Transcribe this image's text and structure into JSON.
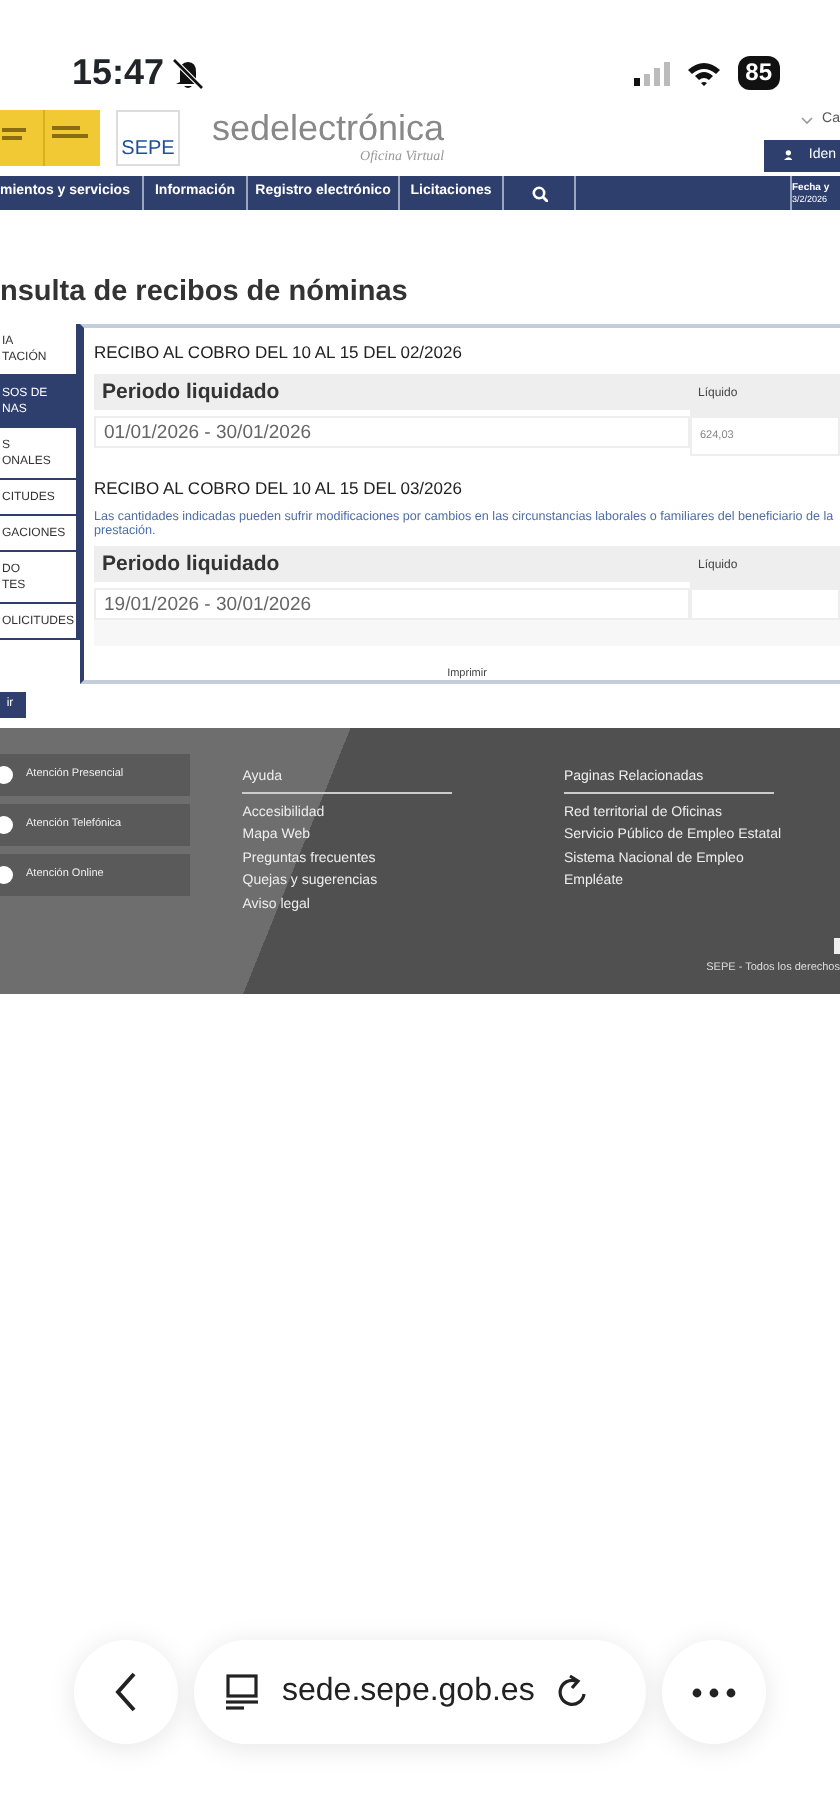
{
  "status_bar": {
    "time": "15:47",
    "battery": "85"
  },
  "header": {
    "logo_text": "SEPE",
    "brand": "sedelectrónica",
    "brand_subtitle": "Oficina Virtual",
    "language_link": "Ca",
    "login_button": "Iden"
  },
  "nav": {
    "items": [
      {
        "kind": "link",
        "label": "mientos y servicios"
      },
      {
        "kind": "link",
        "label": "Información"
      },
      {
        "kind": "link",
        "label": "Registro electrónico"
      },
      {
        "kind": "link",
        "label": "Licitaciones"
      },
      {
        "kind": "search"
      }
    ],
    "date_label": "Fecha y",
    "date": "3/2/2026"
  },
  "page_title": "nsulta de recibos de nóminas",
  "sidebar": {
    "items": [
      {
        "lines": [
          "IA",
          "TACIÓN"
        ],
        "selected": false
      },
      {
        "lines": [
          "SOS DE",
          "NAS"
        ],
        "selected": true
      },
      {
        "lines": [
          "S",
          "ONALES"
        ],
        "selected": false
      },
      {
        "lines": [
          "CITUDES"
        ],
        "selected": false
      },
      {
        "lines": [
          "GACIONES"
        ],
        "selected": false
      },
      {
        "lines": [
          "DO",
          "TES"
        ],
        "selected": false
      },
      {
        "lines": [
          "OLICITUDES"
        ],
        "selected": false
      }
    ]
  },
  "receipts": [
    {
      "title": "RECIBO AL COBRO DEL 10 AL 15 DEL 02/2026",
      "columns": [
        "Periodo liquidado",
        "Líquido"
      ],
      "rows": [
        {
          "period": "01/01/2026  -  30/01/2026",
          "amount": "624,03"
        }
      ]
    },
    {
      "title": "RECIBO AL COBRO DEL 10 AL 15 DEL 03/2026",
      "note": "Las cantidades indicadas pueden sufrir modificaciones por cambios en las circunstancias laborales o familiares del beneficiario de la prestación.",
      "columns": [
        "Periodo liquidado",
        "Líquido"
      ],
      "rows": [
        {
          "period": "19/01/2026  -  30/01/2026"
        }
      ]
    }
  ],
  "print_link": "Imprimir",
  "exit_button": "ir",
  "footer": {
    "contact": [
      "Atención Presencial",
      "Atención Telefónica",
      "Atención Online"
    ],
    "columns": [
      {
        "heading": "Ayuda",
        "links": [
          "Accesibilidad",
          "Mapa Web",
          "Preguntas frecuentes",
          "Quejas y sugerencias",
          "Aviso legal"
        ]
      },
      {
        "heading": "Paginas Relacionadas",
        "links": [
          "Red territorial de Oficinas",
          "Servicio Público de Empleo Estatal",
          "Sistema Nacional de Empleo",
          "Empléate"
        ]
      }
    ],
    "copyright": "SEPE - Todos los derechos"
  },
  "browser": {
    "url": "sede.sepe.gob.es"
  }
}
